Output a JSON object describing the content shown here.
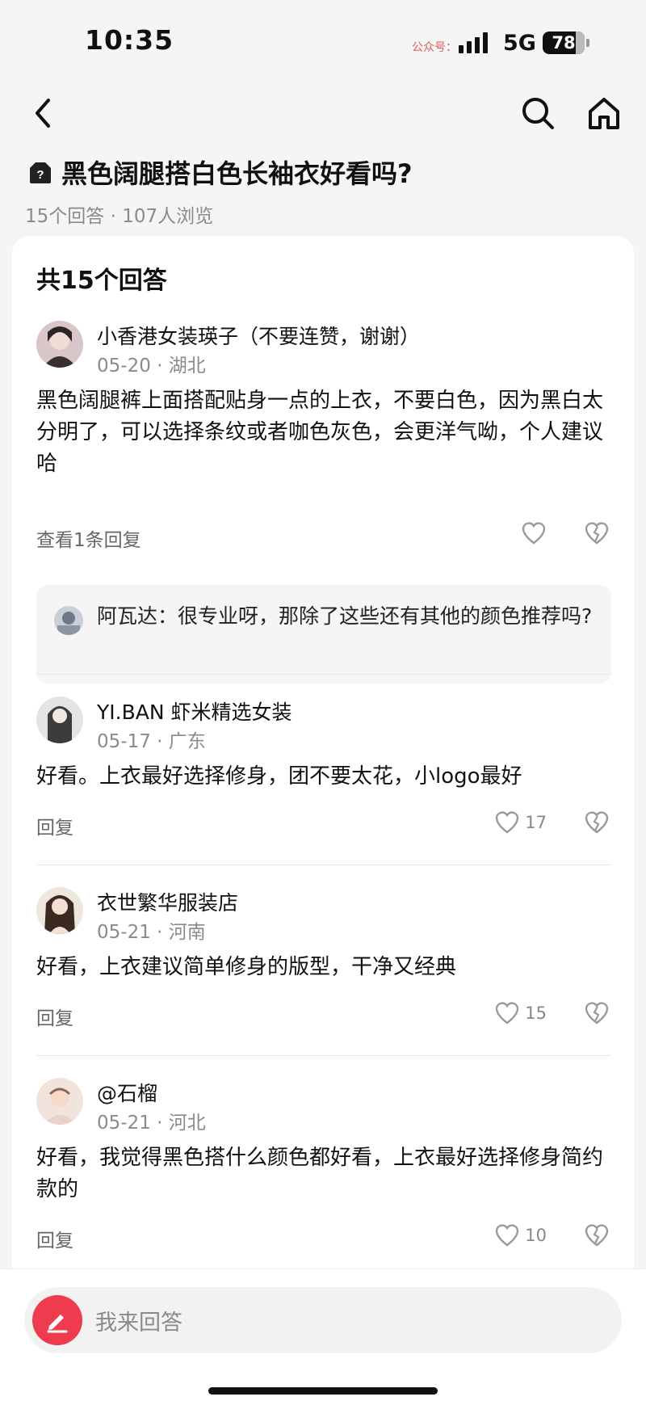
{
  "status": {
    "time": "10:35",
    "watermark": "公众号：",
    "network": "5G",
    "battery": "78"
  },
  "nav": {
    "back_icon": "back-arrow-icon",
    "search_icon": "search-icon",
    "home_icon": "home-icon"
  },
  "question": {
    "title": "黑色阔腿搭白色长袖衣好看吗?",
    "meta": "15个回答 · 107人浏览"
  },
  "answers_header": "共15个回答",
  "answers": [
    {
      "author": "小香港女装瑛子（不要连赞，谢谢）",
      "date": "05-20 · 湖北",
      "content": "黑色阔腿裤上面搭配贴身一点的上衣，不要白色，因为黑白太分明了，可以选择条纹或者咖色灰色，会更洋气呦，个人建议哈",
      "reply_label": "查看1条回复",
      "likes": "",
      "sub_reply": {
        "text": "阿瓦达：很专业呀，那除了这些还有其他的颜色推荐吗?"
      }
    },
    {
      "author": "YI.BAN 虾米精选女装",
      "date": "05-17 · 广东",
      "content": "好看。上衣最好选择修身，团不要太花，小logo最好",
      "reply_label": "回复",
      "likes": "17"
    },
    {
      "author": "衣世繁华服装店",
      "date": "05-21 · 河南",
      "content": "好看，上衣建议简单修身的版型，干净又经典",
      "reply_label": "回复",
      "likes": "15"
    },
    {
      "author": "@石榴",
      "date": "05-21 · 河北",
      "content": "好看，我觉得黑色搭什么颜色都好看，上衣最好选择修身简约款的",
      "reply_label": "回复",
      "likes": "10"
    }
  ],
  "bottom": {
    "placeholder": "我来回答"
  },
  "colors": {
    "accent": "#ef3b4e",
    "meta_gray": "#8a8a8a",
    "card_bg": "#ffffff",
    "page_bg": "#f5f5f5"
  }
}
